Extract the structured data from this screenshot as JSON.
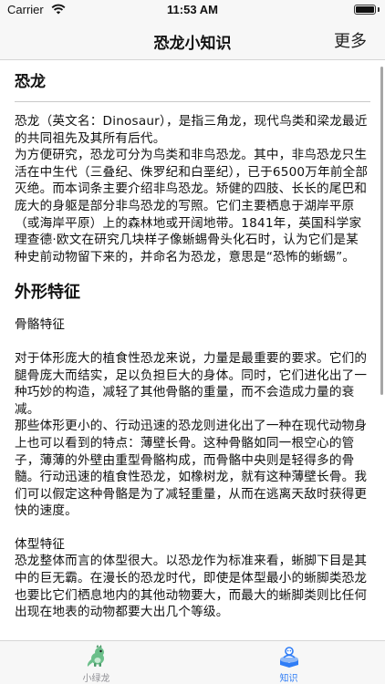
{
  "status_bar": {
    "carrier": "Carrier",
    "time": "11:53 AM"
  },
  "nav": {
    "title": "恐龙小知识",
    "more_label": "更多"
  },
  "article": {
    "title": "恐龙",
    "para1": "恐龙（英文名：Dinosaur），是指三角龙，现代鸟类和梁龙最近的共同祖先及其所有后代。",
    "para2": "为方便研究，恐龙可分为鸟类和非鸟恐龙。其中，非鸟恐龙只生活在中生代（三叠纪、侏罗纪和白垩纪），已于6500万年前全部灭绝。而本词条主要介绍非鸟恐龙。矫健的四肢、长长的尾巴和庞大的身躯是部分非鸟恐龙的写照。它们主要栖息于湖岸平原（或海岸平原）上的森林地或开阔地带。1841年，英国科学家理查德·欧文在研究几块样子像蜥蜴骨头化石时，认为它们是某种史前动物留下来的，并命名为恐龙，意思是“恐怖的蜥蜴”。",
    "section2_title": "外形特征",
    "sub1": "骨骼特征",
    "para3": "对于体形庞大的植食性恐龙来说，力量是最重要的要求。它们的腿骨庞大而结实，足以负担巨大的身体。同时，它们进化出了一种巧妙的构造，减轻了其他骨骼的重量，而不会造成力量的衰减。",
    "para4": "那些体形更小的、行动迅速的恐龙则进化出了一种在现代动物身上也可以看到的特点：薄壁长骨。这种骨骼如同一根空心的管子，薄薄的外壁由重型骨骼构成，而骨骼中央则是轻得多的骨髓。行动迅速的植食性恐龙，如橡树龙，就有这种薄壁长骨。我们可以假定这种骨骼是为了减轻重量，从而在逃离天敌时获得更快的速度。",
    "sub2": "体型特征",
    "para5": "恐龙整体而言的体型很大。以恐龙作为标准来看，蜥脚下目是其中的巨无霸。在漫长的恐龙时代，即使是体型最小的蜥脚类恐龙也要比它们栖息地内的其他动物要大，而最大的蜥脚类则比任何出现在地表的动物都要大出几个等级。"
  },
  "tabs": [
    {
      "label": "小绿龙",
      "icon": "dinosaur-icon"
    },
    {
      "label": "知识",
      "icon": "knowledge-icon"
    }
  ],
  "colors": {
    "accent": "#2f7df6",
    "tab_inactive": "#8e8e93",
    "bar_background": "#f7f7f7"
  }
}
